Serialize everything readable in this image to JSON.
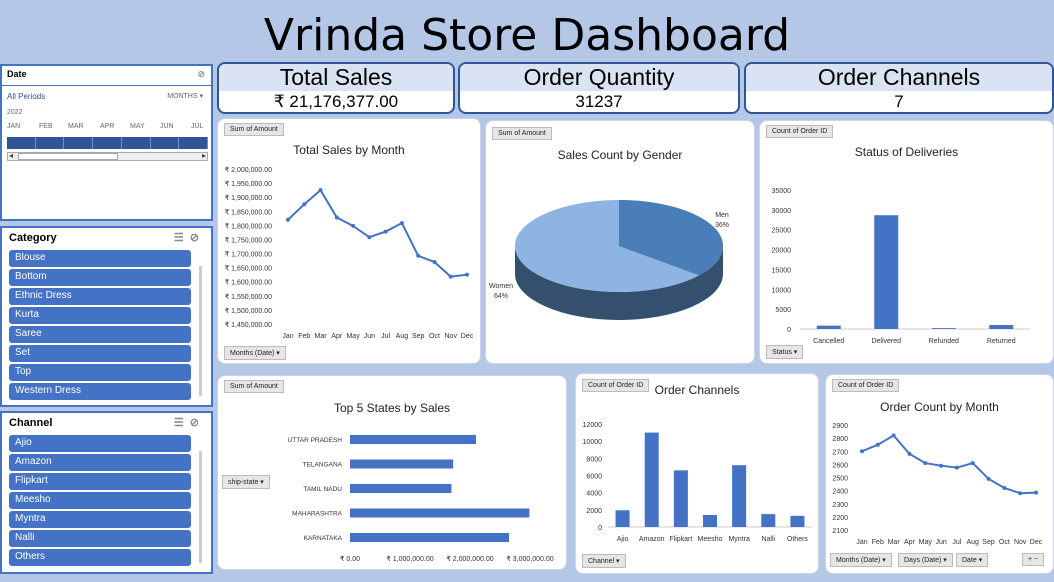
{
  "title": "Vrinda Store Dashboard",
  "date_slicer": {
    "header": "Date",
    "periods": "All Periods",
    "granularity": "MONTHS",
    "year": "2022",
    "months": [
      "JAN",
      "FEB",
      "MAR",
      "APR",
      "MAY",
      "JUN",
      "JUL"
    ]
  },
  "category_slicer": {
    "header": "Category",
    "items": [
      "Blouse",
      "Bottom",
      "Ethnic Dress",
      "Kurta",
      "Saree",
      "Set",
      "Top",
      "Western Dress"
    ]
  },
  "channel_slicer": {
    "header": "Channel",
    "items": [
      "Ajio",
      "Amazon",
      "Flipkart",
      "Meesho",
      "Myntra",
      "Nalli",
      "Others"
    ]
  },
  "kpis": {
    "total_sales": {
      "label": "Total Sales",
      "value": "₹ 21,176,377.00"
    },
    "order_quantity": {
      "label": "Order Quantity",
      "value": "31237"
    },
    "order_channels": {
      "label": "Order Channels",
      "value": "7"
    }
  },
  "colors": {
    "bar": "#4472c4",
    "line": "#4472c4",
    "pie_men": "#4a7eb8",
    "pie_women": "#8eb4e3",
    "accent": "#2f5597"
  },
  "chart_data": [
    {
      "id": "sales_by_month",
      "type": "line",
      "title": "Total Sales by Month",
      "field_button": "Sum of Amount",
      "axis_button": "Months (Date)",
      "categories": [
        "Jan",
        "Feb",
        "Mar",
        "Apr",
        "May",
        "Jun",
        "Jul",
        "Aug",
        "Sep",
        "Oct",
        "Nov",
        "Dec"
      ],
      "values": [
        1820000,
        1875000,
        1925000,
        1828000,
        1798000,
        1758000,
        1778000,
        1808000,
        1692000,
        1670000,
        1618000,
        1625000
      ],
      "yticks": [
        "₹ 2,000,000.00",
        "₹ 1,950,000.00",
        "₹ 1,900,000.00",
        "₹ 1,850,000.00",
        "₹ 1,800,000.00",
        "₹ 1,750,000.00",
        "₹ 1,700,000.00",
        "₹ 1,650,000.00",
        "₹ 1,600,000.00",
        "₹ 1,550,000.00",
        "₹ 1,500,000.00",
        "₹ 1,450,000.00"
      ],
      "ylim": [
        1450000,
        2000000
      ]
    },
    {
      "id": "sales_by_gender",
      "type": "pie",
      "title": "Sales Count by Gender",
      "field_button": "Sum of Amount",
      "slices": [
        {
          "name": "Men",
          "value": 36,
          "label": "36%"
        },
        {
          "name": "Women",
          "value": 64,
          "label": "64%"
        }
      ]
    },
    {
      "id": "delivery_status",
      "type": "bar",
      "title": "Status of Deliveries",
      "field_button": "Count of Order ID",
      "axis_button": "Status",
      "categories": [
        "Cancelled",
        "Delivered",
        "Refunded",
        "Returned"
      ],
      "values": [
        850,
        28650,
        220,
        1000
      ],
      "yticks": [
        "35000",
        "30000",
        "25000",
        "20000",
        "15000",
        "10000",
        "5000",
        "0"
      ],
      "ylim": [
        0,
        35000
      ]
    },
    {
      "id": "top_states",
      "type": "bar",
      "orientation": "horizontal",
      "title": "Top 5 States by Sales",
      "field_button": "Sum of Amount",
      "axis_button": "ship-state",
      "categories": [
        "UTTAR PRADESH",
        "TELANGANA",
        "TAMIL NADU",
        "MAHARASHTRA",
        "KARNATAKA"
      ],
      "values": [
        2100000,
        1720000,
        1690000,
        2990000,
        2650000
      ],
      "xticks": [
        "₹ 0.00",
        "₹ 1,000,000.00",
        "₹ 2,000,000.00",
        "₹ 3,000,000.00"
      ],
      "xlim": [
        0,
        3000000
      ]
    },
    {
      "id": "order_channels",
      "type": "bar",
      "title": "Order Channels",
      "field_button": "Count of Order ID",
      "axis_button": "Channel",
      "categories": [
        "Ajio",
        "Amazon",
        "Flipkart",
        "Meesho",
        "Myntra",
        "Nalli",
        "Others"
      ],
      "values": [
        1950,
        11000,
        6600,
        1400,
        7200,
        1500,
        1300
      ],
      "yticks": [
        "12000",
        "10000",
        "8000",
        "6000",
        "4000",
        "2000",
        "0"
      ],
      "ylim": [
        0,
        12000
      ]
    },
    {
      "id": "order_count_by_month",
      "type": "line",
      "title": "Order Count by Month",
      "field_button": "Count of Order ID",
      "axis_buttons": [
        "Months (Date)",
        "Days (Date)",
        "Date"
      ],
      "categories": [
        "Jan",
        "Feb",
        "Mar",
        "Apr",
        "May",
        "Jun",
        "Jul",
        "Aug",
        "Sep",
        "Oct",
        "Nov",
        "Dec"
      ],
      "values": [
        2700,
        2750,
        2820,
        2680,
        2610,
        2590,
        2575,
        2610,
        2490,
        2420,
        2380,
        2385
      ],
      "yticks": [
        "2900",
        "2800",
        "2700",
        "2600",
        "2500",
        "2400",
        "2300",
        "2200",
        "2100"
      ],
      "ylim": [
        2100,
        2900
      ]
    }
  ]
}
